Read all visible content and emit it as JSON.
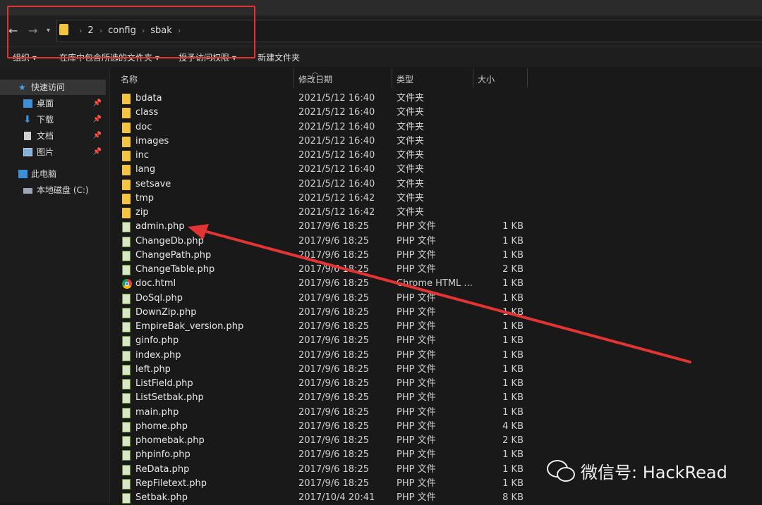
{
  "breadcrumb": [
    "2",
    "config",
    "sbak"
  ],
  "toolbar": {
    "organize": "组织 ▾",
    "include_in_library": "在库中包含所选的文件夹 ▾",
    "grant_access": "授予访问权限 ▾",
    "new_folder": "新建文件夹"
  },
  "sidebar": {
    "quick_access": "快速访问",
    "desktop": "桌面",
    "downloads": "下载",
    "documents": "文档",
    "pictures": "图片",
    "this_pc": "此电脑",
    "local_disk": "本地磁盘 (C:)"
  },
  "columns": {
    "name": "名称",
    "date": "修改日期",
    "type": "类型",
    "size": "大小"
  },
  "files": [
    {
      "name": "bdata",
      "date": "2021/5/12 16:40",
      "type": "文件夹",
      "size": "",
      "icon": "folder"
    },
    {
      "name": "class",
      "date": "2021/5/12 16:40",
      "type": "文件夹",
      "size": "",
      "icon": "folder"
    },
    {
      "name": "doc",
      "date": "2021/5/12 16:40",
      "type": "文件夹",
      "size": "",
      "icon": "folder"
    },
    {
      "name": "images",
      "date": "2021/5/12 16:40",
      "type": "文件夹",
      "size": "",
      "icon": "folder"
    },
    {
      "name": "inc",
      "date": "2021/5/12 16:40",
      "type": "文件夹",
      "size": "",
      "icon": "folder"
    },
    {
      "name": "lang",
      "date": "2021/5/12 16:40",
      "type": "文件夹",
      "size": "",
      "icon": "folder"
    },
    {
      "name": "setsave",
      "date": "2021/5/12 16:40",
      "type": "文件夹",
      "size": "",
      "icon": "folder"
    },
    {
      "name": "tmp",
      "date": "2021/5/12 16:42",
      "type": "文件夹",
      "size": "",
      "icon": "folder"
    },
    {
      "name": "zip",
      "date": "2021/5/12 16:42",
      "type": "文件夹",
      "size": "",
      "icon": "folder"
    },
    {
      "name": "admin.php",
      "date": "2017/9/6 18:25",
      "type": "PHP 文件",
      "size": "1 KB",
      "icon": "php"
    },
    {
      "name": "ChangeDb.php",
      "date": "2017/9/6 18:25",
      "type": "PHP 文件",
      "size": "1 KB",
      "icon": "php"
    },
    {
      "name": "ChangePath.php",
      "date": "2017/9/6 18:25",
      "type": "PHP 文件",
      "size": "1 KB",
      "icon": "php"
    },
    {
      "name": "ChangeTable.php",
      "date": "2017/9/6 18:25",
      "type": "PHP 文件",
      "size": "2 KB",
      "icon": "php"
    },
    {
      "name": "doc.html",
      "date": "2017/9/6 18:25",
      "type": "Chrome HTML ...",
      "size": "1 KB",
      "icon": "chrome"
    },
    {
      "name": "DoSql.php",
      "date": "2017/9/6 18:25",
      "type": "PHP 文件",
      "size": "1 KB",
      "icon": "php"
    },
    {
      "name": "DownZip.php",
      "date": "2017/9/6 18:25",
      "type": "PHP 文件",
      "size": "1 KB",
      "icon": "php"
    },
    {
      "name": "EmpireBak_version.php",
      "date": "2017/9/6 18:25",
      "type": "PHP 文件",
      "size": "1 KB",
      "icon": "php"
    },
    {
      "name": "ginfo.php",
      "date": "2017/9/6 18:25",
      "type": "PHP 文件",
      "size": "1 KB",
      "icon": "php"
    },
    {
      "name": "index.php",
      "date": "2017/9/6 18:25",
      "type": "PHP 文件",
      "size": "1 KB",
      "icon": "php"
    },
    {
      "name": "left.php",
      "date": "2017/9/6 18:25",
      "type": "PHP 文件",
      "size": "1 KB",
      "icon": "php"
    },
    {
      "name": "ListField.php",
      "date": "2017/9/6 18:25",
      "type": "PHP 文件",
      "size": "1 KB",
      "icon": "php"
    },
    {
      "name": "ListSetbak.php",
      "date": "2017/9/6 18:25",
      "type": "PHP 文件",
      "size": "1 KB",
      "icon": "php"
    },
    {
      "name": "main.php",
      "date": "2017/9/6 18:25",
      "type": "PHP 文件",
      "size": "1 KB",
      "icon": "php"
    },
    {
      "name": "phome.php",
      "date": "2017/9/6 18:25",
      "type": "PHP 文件",
      "size": "4 KB",
      "icon": "php"
    },
    {
      "name": "phomebak.php",
      "date": "2017/9/6 18:25",
      "type": "PHP 文件",
      "size": "2 KB",
      "icon": "php"
    },
    {
      "name": "phpinfo.php",
      "date": "2017/9/6 18:25",
      "type": "PHP 文件",
      "size": "1 KB",
      "icon": "php"
    },
    {
      "name": "ReData.php",
      "date": "2017/9/6 18:25",
      "type": "PHP 文件",
      "size": "1 KB",
      "icon": "php"
    },
    {
      "name": "RepFiletext.php",
      "date": "2017/9/6 18:25",
      "type": "PHP 文件",
      "size": "1 KB",
      "icon": "php"
    },
    {
      "name": "Setbak.php",
      "date": "2017/10/4 20:41",
      "type": "PHP 文件",
      "size": "8 KB",
      "icon": "php"
    }
  ],
  "watermark": "微信号: HackRead",
  "colors": {
    "annotation_red": "#e33434",
    "folder": "#f5c542",
    "background": "#191919"
  }
}
